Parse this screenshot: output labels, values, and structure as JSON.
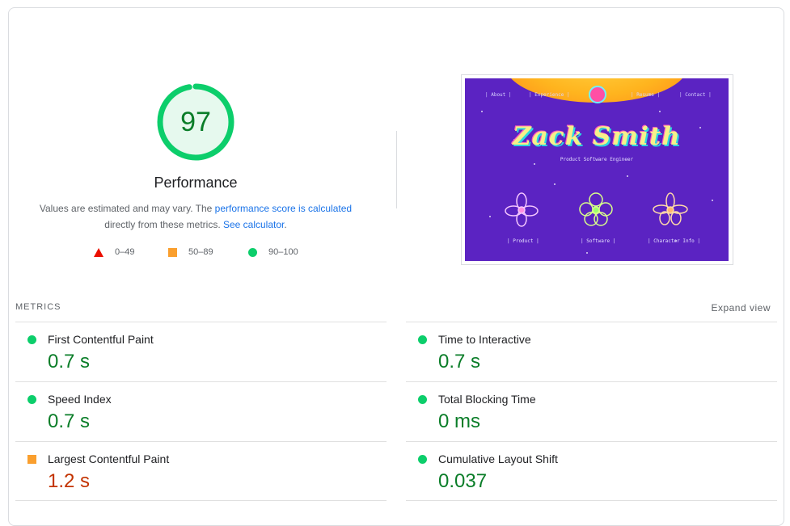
{
  "score": {
    "value": "97",
    "fraction": 0.97,
    "title": "Performance",
    "color": "#0cce6b",
    "text_color": "#0a7d28",
    "bg_color": "#e6f9ee"
  },
  "description": {
    "prefix": "Values are estimated and may vary. The ",
    "link1": "performance score is calculated",
    "middle": "directly from these metrics. ",
    "link2": "See calculator",
    "suffix": "."
  },
  "legend": [
    {
      "range": "0–49",
      "shape": "triangle",
      "color": "#eb0f00"
    },
    {
      "range": "50–89",
      "shape": "square",
      "color": "#fa9f2e"
    },
    {
      "range": "90–100",
      "shape": "circle",
      "color": "#0cce6b"
    }
  ],
  "screenshot": {
    "nav": [
      "| About |",
      "| Experience |",
      "| Resume |",
      "| Contact |"
    ],
    "name": "Zack Smith",
    "subtitle": "Product Software Engineer",
    "links": [
      "| Product |",
      "| Software |",
      "| Character Info |"
    ]
  },
  "metrics_header": {
    "label": "METRICS",
    "expand": "Expand view"
  },
  "metrics": [
    {
      "name": "First Contentful Paint",
      "value": "0.7 s",
      "status": "pass"
    },
    {
      "name": "Time to Interactive",
      "value": "0.7 s",
      "status": "pass"
    },
    {
      "name": "Speed Index",
      "value": "0.7 s",
      "status": "pass"
    },
    {
      "name": "Total Blocking Time",
      "value": "0 ms",
      "status": "pass"
    },
    {
      "name": "Largest Contentful Paint",
      "value": "1.2 s",
      "status": "average"
    },
    {
      "name": "Cumulative Layout Shift",
      "value": "0.037",
      "status": "pass"
    }
  ]
}
